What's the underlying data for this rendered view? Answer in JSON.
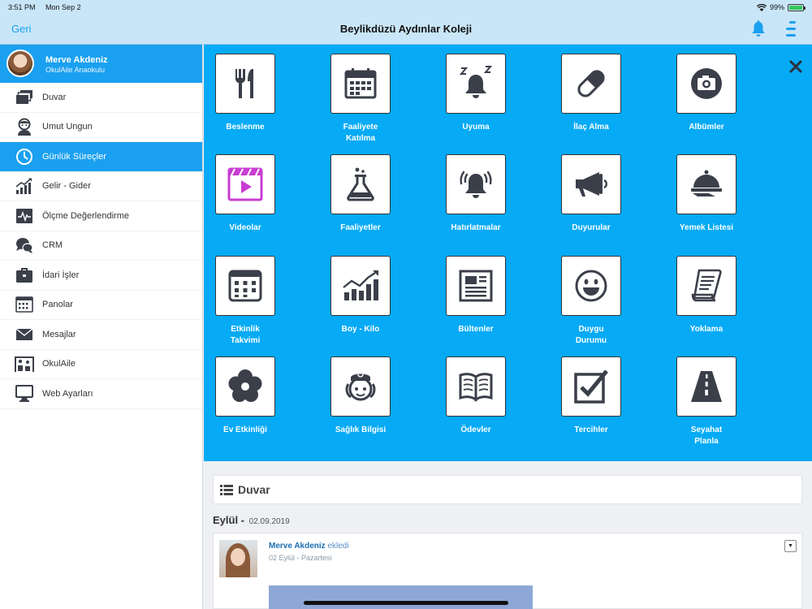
{
  "status": {
    "time": "3:51 PM",
    "date": "Mon Sep 2",
    "battery": "99%",
    "battery_level": 0.99
  },
  "nav": {
    "back": "Geri",
    "title": "Beylikdüzü Aydınlar Koleji"
  },
  "profile": {
    "name": "Merve Akdeniz",
    "school": "OkulAile Anaokulu"
  },
  "sidebar": {
    "items": [
      {
        "label": "Duvar",
        "icon": "wall-icon"
      },
      {
        "label": "Umut Ungun",
        "icon": "child-icon"
      },
      {
        "label": "Günlük Süreçler",
        "icon": "clock-icon",
        "active": true
      },
      {
        "label": "Gelir - Gider",
        "icon": "chart-icon"
      },
      {
        "label": "Ölçme Değerlendirme",
        "icon": "pulse-icon"
      },
      {
        "label": "CRM",
        "icon": "chat-icon"
      },
      {
        "label": "İdari İşler",
        "icon": "briefcase-icon"
      },
      {
        "label": "Panolar",
        "icon": "board-icon"
      },
      {
        "label": "Mesajlar",
        "icon": "mail-icon"
      },
      {
        "label": "OkulAile",
        "icon": "family-icon"
      },
      {
        "label": "Web Ayarları",
        "icon": "monitor-icon"
      }
    ]
  },
  "tiles": [
    {
      "line1": "Beslenme",
      "line2": "",
      "icon": "cutlery-icon"
    },
    {
      "line1": "Faaliyete",
      "line2": "Katılma",
      "icon": "calendar-icon"
    },
    {
      "line1": "Uyuma",
      "line2": "",
      "icon": "sleep-bell-icon"
    },
    {
      "line1": "İlaç Alma",
      "line2": "",
      "icon": "pill-icon"
    },
    {
      "line1": "Albümler",
      "line2": "",
      "icon": "camera-icon"
    },
    {
      "line1": "Videolar",
      "line2": "",
      "icon": "video-icon"
    },
    {
      "line1": "Faaliyetler",
      "line2": "",
      "icon": "flask-icon"
    },
    {
      "line1": "Hatırlatmalar",
      "line2": "",
      "icon": "alarm-bell-icon"
    },
    {
      "line1": "Duyurular",
      "line2": "",
      "icon": "megaphone-icon"
    },
    {
      "line1": "Yemek Listesi",
      "line2": "",
      "icon": "cloche-icon"
    },
    {
      "line1": "Etkinlik",
      "line2": "Takvimi",
      "icon": "event-calendar-icon"
    },
    {
      "line1": "Boy - Kilo",
      "line2": "",
      "icon": "growth-chart-icon"
    },
    {
      "line1": "Bültenler",
      "line2": "",
      "icon": "newspaper-icon"
    },
    {
      "line1": "Duygu",
      "line2": "Durumu",
      "icon": "smiley-icon"
    },
    {
      "line1": "Yoklama",
      "line2": "",
      "icon": "scroll-icon"
    },
    {
      "line1": "Ev Etkinliği",
      "line2": "",
      "icon": "flower-icon"
    },
    {
      "line1": "Sağlık Bilgisi",
      "line2": "",
      "icon": "nurse-icon"
    },
    {
      "line1": "Ödevler",
      "line2": "",
      "icon": "book-icon"
    },
    {
      "line1": "Tercihler",
      "line2": "",
      "icon": "checkbox-icon"
    },
    {
      "line1": "Seyahat",
      "line2": "Planla",
      "icon": "road-icon"
    }
  ],
  "wall": {
    "title": "Duvar",
    "month": "Eylül -",
    "date": "02.09.2019"
  },
  "post": {
    "author": "Merve Akdeniz",
    "action": "ekledi",
    "date": "02 Eylül - Pazartesi"
  },
  "colors": {
    "accent": "#1aa0f0",
    "panel": "#06aaf5",
    "video": "#c83dd2",
    "icon": "#3b3f4a"
  }
}
